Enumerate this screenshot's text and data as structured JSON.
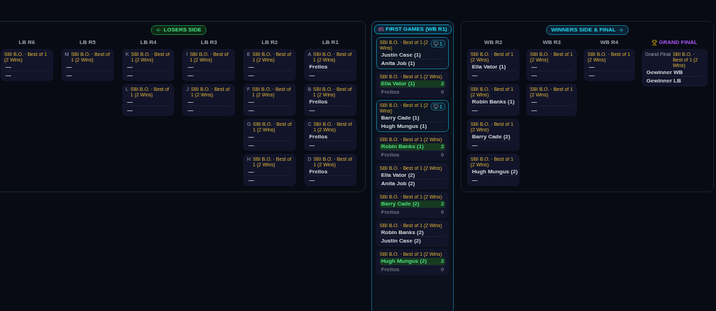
{
  "losers_side": {
    "title": "LOSERS SIDE",
    "rounds": [
      {
        "label": "LB R6",
        "kind": "round",
        "matches": [
          {
            "format": "SBI B.O. · Best of 1 (2 Wins)",
            "live": false,
            "players": [
              {
                "name": "—",
                "kind": "open"
              },
              {
                "name": "—",
                "kind": "open"
              }
            ]
          }
        ]
      },
      {
        "label": "LB R5",
        "kind": "round",
        "matches": [
          {
            "code": "M",
            "format": "SBI B.O. · Best of 1 (2 Wins)",
            "live": false,
            "players": [
              {
                "name": "—",
                "kind": "open"
              },
              {
                "name": "—",
                "kind": "open"
              }
            ]
          }
        ]
      },
      {
        "label": "LB R4",
        "kind": "round",
        "matches": [
          {
            "code": "K",
            "format": "SBI B.O. · Best of 1 (2 Wins)",
            "live": false,
            "players": [
              {
                "name": "—",
                "kind": "open"
              },
              {
                "name": "—",
                "kind": "open"
              }
            ]
          },
          {
            "code": "L",
            "format": "SBI B.O. · Best of 1 (2 Wins)",
            "live": false,
            "players": [
              {
                "name": "—",
                "kind": "open"
              },
              {
                "name": "—",
                "kind": "open"
              }
            ]
          }
        ]
      },
      {
        "label": "LB R3",
        "kind": "round",
        "matches": [
          {
            "code": "I",
            "format": "SBI B.O. · Best of 1 (2 Wins)",
            "live": false,
            "players": [
              {
                "name": "—",
                "kind": "open"
              },
              {
                "name": "—",
                "kind": "open"
              }
            ]
          },
          {
            "code": "J",
            "format": "SBI B.O. · Best of 1 (2 Wins)",
            "live": false,
            "players": [
              {
                "name": "—",
                "kind": "open"
              },
              {
                "name": "—",
                "kind": "open"
              }
            ]
          }
        ]
      },
      {
        "label": "LB R2",
        "kind": "round",
        "matches": [
          {
            "code": "E",
            "format": "SBI B.O. · Best of 1 (2 Wins)",
            "live": false,
            "players": [
              {
                "name": "—",
                "kind": "open"
              },
              {
                "name": "—",
                "kind": "open"
              }
            ]
          },
          {
            "code": "F",
            "format": "SBI B.O. · Best of 1 (2 Wins)",
            "live": false,
            "players": [
              {
                "name": "—",
                "kind": "open"
              },
              {
                "name": "—",
                "kind": "open"
              }
            ]
          },
          {
            "code": "G",
            "format": "SBI B.O. · Best of 1 (2 Wins)",
            "live": false,
            "players": [
              {
                "name": "—",
                "kind": "open"
              },
              {
                "name": "—",
                "kind": "open"
              }
            ]
          },
          {
            "code": "H",
            "format": "SBI B.O. · Best of 1 (2 Wins)",
            "live": false,
            "players": [
              {
                "name": "—",
                "kind": "open"
              },
              {
                "name": "—",
                "kind": "open"
              }
            ]
          }
        ]
      },
      {
        "label": "LB R1",
        "kind": "round",
        "matches": [
          {
            "code": "A",
            "format": "SBI B.O. · Best of 1 (2 Wins)",
            "live": false,
            "players": [
              {
                "name": "Freilos",
                "kind": "open"
              },
              {
                "name": "—",
                "kind": "open"
              }
            ]
          },
          {
            "code": "B",
            "format": "SBI B.O. · Best of 1 (2 Wins)",
            "live": false,
            "players": [
              {
                "name": "Freilos",
                "kind": "open"
              },
              {
                "name": "—",
                "kind": "open"
              }
            ]
          },
          {
            "code": "C",
            "format": "SBI B.O. · Best of 1 (2 Wins)",
            "live": false,
            "players": [
              {
                "name": "Freilos",
                "kind": "open"
              },
              {
                "name": "—",
                "kind": "open"
              }
            ]
          },
          {
            "code": "D",
            "format": "SBI B.O. · Best of 1 (2 Wins)",
            "live": false,
            "players": [
              {
                "name": "Freilos",
                "kind": "open"
              },
              {
                "name": "—",
                "kind": "open"
              }
            ]
          }
        ]
      }
    ]
  },
  "first_games": {
    "title": "FIRST GAMES (WB R1)",
    "matches": [
      {
        "format": "SBI B.O. · Best of 1 (2 Wins)",
        "live": true,
        "table": "1",
        "players": [
          {
            "name": "Justin Case (1)",
            "kind": "open"
          },
          {
            "name": "Anita Job (1)",
            "kind": "open"
          }
        ]
      },
      {
        "format": "SBI B.O. · Best of 1 (2 Wins)",
        "live": false,
        "players": [
          {
            "name": "Ella Vator (1)",
            "kind": "won",
            "score": "2"
          },
          {
            "name": "Freilos",
            "kind": "lost",
            "score": "0"
          }
        ]
      },
      {
        "format": "SBI B.O. · Best of 1 (2 Wins)",
        "live": true,
        "table": "1",
        "players": [
          {
            "name": "Barry Cade (1)",
            "kind": "open"
          },
          {
            "name": "Hugh Mungus (1)",
            "kind": "open"
          }
        ]
      },
      {
        "format": "SBI B.O. · Best of 1 (2 Wins)",
        "live": false,
        "players": [
          {
            "name": "Robin Banks (1)",
            "kind": "won",
            "score": "2"
          },
          {
            "name": "Freilos",
            "kind": "lost",
            "score": "0"
          }
        ]
      },
      {
        "format": "SBI B.O. · Best of 1 (2 Wins)",
        "live": false,
        "players": [
          {
            "name": "Ella Vator (2)",
            "kind": "open"
          },
          {
            "name": "Anita Job (2)",
            "kind": "open"
          }
        ]
      },
      {
        "format": "SBI B.O. · Best of 1 (2 Wins)",
        "live": false,
        "players": [
          {
            "name": "Barry Cade (2)",
            "kind": "won",
            "score": "2"
          },
          {
            "name": "Freilos",
            "kind": "lost",
            "score": "0"
          }
        ]
      },
      {
        "format": "SBI B.O. · Best of 1 (2 Wins)",
        "live": false,
        "players": [
          {
            "name": "Robin Banks (2)",
            "kind": "open"
          },
          {
            "name": "Justin Case (2)",
            "kind": "open"
          }
        ]
      },
      {
        "format": "SBI B.O. · Best of 1 (2 Wins)",
        "live": false,
        "players": [
          {
            "name": "Hugh Mungus (2)",
            "kind": "won",
            "score": "2"
          },
          {
            "name": "Freilos",
            "kind": "lost",
            "score": "0"
          }
        ]
      }
    ]
  },
  "winners_side": {
    "title": "WINNERS SIDE & FINAL",
    "rounds": [
      {
        "label": "WB R2",
        "kind": "round",
        "matches": [
          {
            "format": "SBI B.O. · Best of 1 (2 Wins)",
            "live": false,
            "players": [
              {
                "name": "Ella Vator (1)",
                "kind": "open"
              },
              {
                "name": "—",
                "kind": "open"
              }
            ]
          },
          {
            "format": "SBI B.O. · Best of 1 (2 Wins)",
            "live": false,
            "players": [
              {
                "name": "Robin Banks (1)",
                "kind": "open"
              },
              {
                "name": "—",
                "kind": "open"
              }
            ]
          },
          {
            "format": "SBI B.O. · Best of 1 (2 Wins)",
            "live": false,
            "players": [
              {
                "name": "Barry Cade (2)",
                "kind": "open"
              },
              {
                "name": "—",
                "kind": "open"
              }
            ]
          },
          {
            "format": "SBI B.O. · Best of 1 (2 Wins)",
            "live": false,
            "players": [
              {
                "name": "Hugh Mungus (2)",
                "kind": "open"
              },
              {
                "name": "—",
                "kind": "open"
              }
            ]
          }
        ]
      },
      {
        "label": "WB R3",
        "kind": "round",
        "matches": [
          {
            "format": "SBI B.O. · Best of 1 (2 Wins)",
            "live": false,
            "players": [
              {
                "name": "—",
                "kind": "open"
              },
              {
                "name": "—",
                "kind": "open"
              }
            ]
          },
          {
            "format": "SBI B.O. · Best of 1 (2 Wins)",
            "live": false,
            "players": [
              {
                "name": "—",
                "kind": "open"
              },
              {
                "name": "—",
                "kind": "open"
              }
            ]
          }
        ]
      },
      {
        "label": "WB R4",
        "kind": "round",
        "matches": [
          {
            "format": "SBI B.O. · Best of 1 (2 Wins)",
            "live": false,
            "players": [
              {
                "name": "—",
                "kind": "open"
              },
              {
                "name": "—",
                "kind": "open"
              }
            ]
          }
        ]
      },
      {
        "label": "GRAND FINAL",
        "kind": "final",
        "matches": [
          {
            "code": "Grand Final",
            "format": "SBI B.O. · Best of 1 (2 Wins)",
            "live": false,
            "players": [
              {
                "name": "Gewinner WB",
                "kind": "open"
              },
              {
                "name": "Gewinner LB",
                "kind": "open"
              }
            ]
          }
        ]
      }
    ]
  }
}
